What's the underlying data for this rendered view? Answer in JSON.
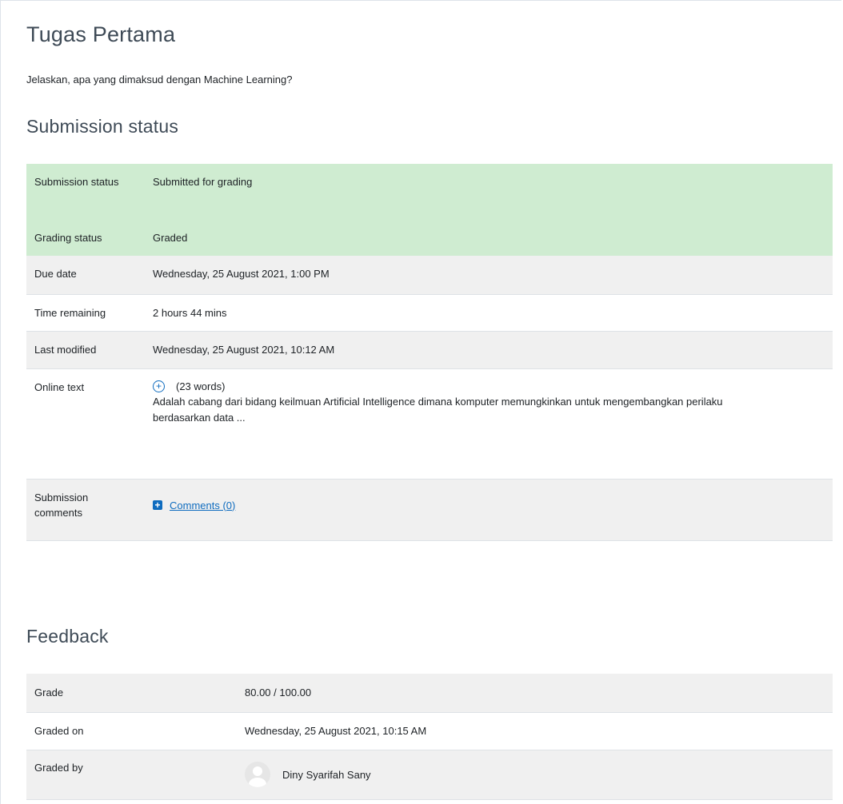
{
  "assignment": {
    "title": "Tugas Pertama",
    "question": "Jelaskan, apa yang dimaksud dengan Machine Learning?"
  },
  "submission": {
    "heading": "Submission status",
    "rows": {
      "submission_status": {
        "label": "Submission status",
        "value": "Submitted for grading"
      },
      "grading_status": {
        "label": "Grading status",
        "value": "Graded"
      },
      "due_date": {
        "label": "Due date",
        "value": "Wednesday, 25 August 2021, 1:00 PM"
      },
      "time_remaining": {
        "label": "Time remaining",
        "value": "2 hours 44 mins"
      },
      "last_modified": {
        "label": "Last modified",
        "value": "Wednesday, 25 August 2021, 10:12 AM"
      },
      "online_text": {
        "label": "Online text",
        "word_count": "(23 words)",
        "preview": "Adalah cabang dari bidang keilmuan Artificial Intelligence dimana komputer memungkinkan untuk mengembangkan perilaku berdasarkan data ..."
      },
      "comments": {
        "label": "Submission comments",
        "link": "Comments (0)"
      }
    }
  },
  "feedback": {
    "heading": "Feedback",
    "rows": {
      "grade": {
        "label": "Grade",
        "value": "80.00 / 100.00"
      },
      "graded_on": {
        "label": "Graded on",
        "value": "Wednesday, 25 August 2021, 10:15 AM"
      },
      "graded_by": {
        "label": "Graded by",
        "value": "Diny Syarifah Sany"
      }
    }
  },
  "icons": {
    "expand": "plus-circle-icon",
    "add_comment": "plus-square-icon",
    "grader_avatar": "user-avatar-icon"
  },
  "colors": {
    "success_row": "#cfecd1",
    "gray_row": "#f0f0f0",
    "link": "#0f6cbf",
    "heading": "#3e4a56"
  }
}
